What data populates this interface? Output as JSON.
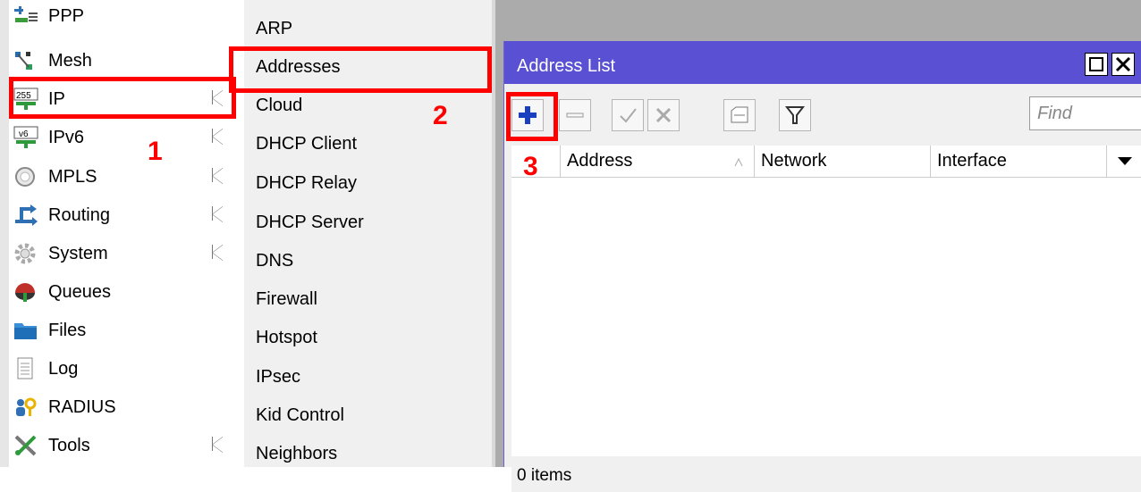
{
  "main_menu": {
    "items": [
      {
        "label": "PPP",
        "icon": "ppp-icon",
        "has_submenu": false
      },
      {
        "label": "Mesh",
        "icon": "mesh-icon",
        "has_submenu": false
      },
      {
        "label": "IP",
        "icon": "ip-icon",
        "has_submenu": true
      },
      {
        "label": "IPv6",
        "icon": "ipv6-icon",
        "has_submenu": true
      },
      {
        "label": "MPLS",
        "icon": "mpls-icon",
        "has_submenu": true
      },
      {
        "label": "Routing",
        "icon": "routing-icon",
        "has_submenu": true
      },
      {
        "label": "System",
        "icon": "system-icon",
        "has_submenu": true
      },
      {
        "label": "Queues",
        "icon": "queues-icon",
        "has_submenu": false
      },
      {
        "label": "Files",
        "icon": "files-icon",
        "has_submenu": false
      },
      {
        "label": "Log",
        "icon": "log-icon",
        "has_submenu": false
      },
      {
        "label": "RADIUS",
        "icon": "radius-icon",
        "has_submenu": false
      },
      {
        "label": "Tools",
        "icon": "tools-icon",
        "has_submenu": true
      }
    ],
    "ip_icon_text": "255",
    "ipv6_icon_text": "v6"
  },
  "submenu": {
    "items": [
      "ARP",
      "Addresses",
      "Cloud",
      "DHCP Client",
      "DHCP Relay",
      "DHCP Server",
      "DNS",
      "Firewall",
      "Hotspot",
      "IPsec",
      "Kid Control",
      "Neighbors"
    ]
  },
  "window": {
    "title": "Address List",
    "find_placeholder": "Find",
    "columns": [
      "Address",
      "Network",
      "Interface"
    ],
    "status": "0 items",
    "toolbar": [
      "add-icon",
      "remove-icon",
      "enable-icon",
      "disable-icon",
      "comment-icon",
      "filter-icon"
    ]
  },
  "annotations": {
    "step1": "1",
    "step2": "2",
    "step3": "3"
  },
  "colors": {
    "annotation": "#ff0000",
    "titlebar": "#5a50d4",
    "add_icon": "#1a3fbf"
  }
}
